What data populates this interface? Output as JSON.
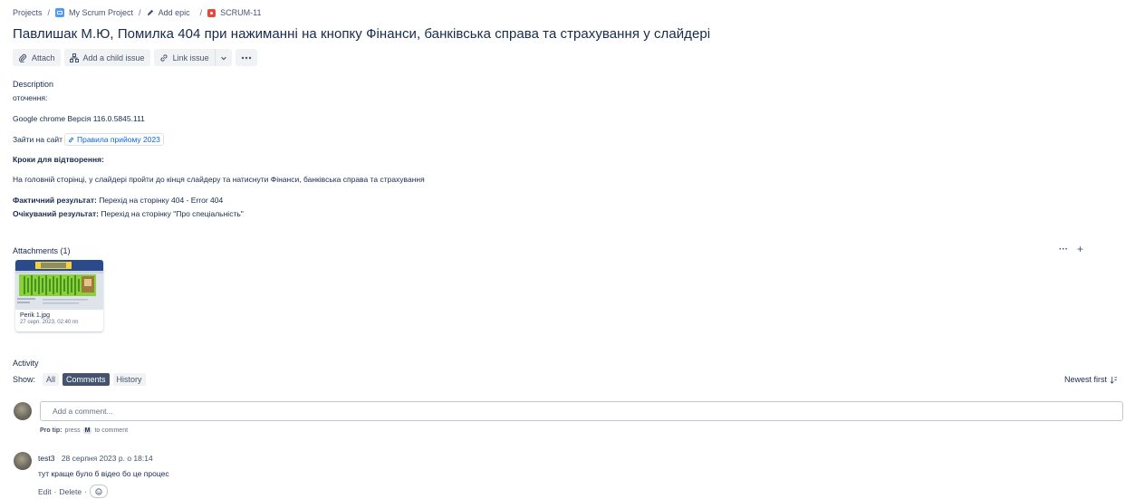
{
  "breadcrumb": {
    "projects": "Projects",
    "project": "My Scrum Project",
    "add_epic": "Add epic",
    "issue_key": "SCRUM-11",
    "separator": "/"
  },
  "issue": {
    "title": "Павлишак М.Ю, Помилка 404 при нажиманні на кнопку Фінанси, банківська справа та страхування у слайдері"
  },
  "toolbar": {
    "attach": "Attach",
    "add_child": "Add a child issue",
    "link_issue": "Link issue"
  },
  "description": {
    "heading": "Description",
    "env_label": "оточення:",
    "browser": "Google chrome Версія 116.0.5845.111",
    "site_prefix": "Зайти на сайт",
    "site_link": "Правила прийому 2023",
    "steps_heading": "Кроки для відтворення:",
    "step_text": "На головній сторінці, у слайдері пройти до кінця слайдеру та натиснути Фінанси, банківська справа та страхування",
    "actual_label": "Фактичний результат:",
    "actual_value": " Перехід на сторінку 404 - Error 404",
    "expected_label": "Очікуваний результат:",
    "expected_value": " Перехід на сторінку \"Про спеціальність\""
  },
  "attachments": {
    "heading": "Attachments (1)",
    "more_label": "···",
    "add_label": "+",
    "items": [
      {
        "name": "Perik 1.jpg",
        "date": "27 серп. 2023, 02:40 пп"
      }
    ]
  },
  "activity": {
    "heading": "Activity",
    "show_label": "Show:",
    "filters": [
      "All",
      "Comments",
      "History"
    ],
    "active_filter": "Comments",
    "sort_label": "Newest first",
    "comment_placeholder": "Add a comment...",
    "pro_tip_label": "Pro tip:",
    "pro_tip_press": "press",
    "pro_tip_key": "M",
    "pro_tip_suffix": "to comment",
    "comments": [
      {
        "author": "test3",
        "timestamp": "28 серпня 2023 р. о 18:14",
        "body": "тут краще було б відео бо це процес",
        "edit": "Edit",
        "delete": "Delete"
      }
    ]
  },
  "colors": {
    "text": "#172b4d",
    "subtle": "#44546f",
    "link": "#0c66e4",
    "bug": "#e5493a",
    "active_chip": "#44546f"
  }
}
